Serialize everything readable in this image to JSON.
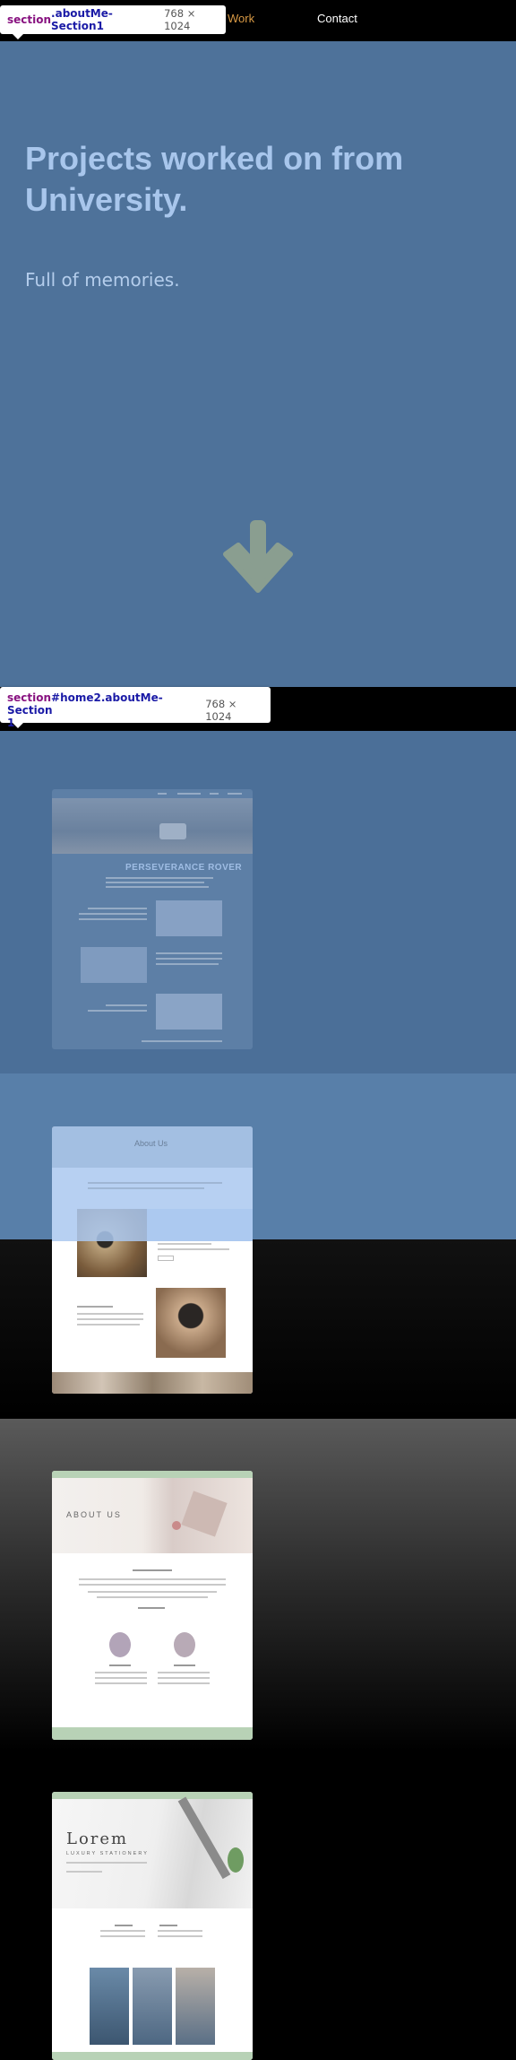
{
  "nav": {
    "work": "Work",
    "contact": "Contact"
  },
  "inspector": {
    "badge1": {
      "tag": "section",
      "cls": ".aboutMe-Section1",
      "dim": "768 × 1024"
    },
    "badge2": {
      "tag": "section",
      "cls": "#home2.aboutMe-Section",
      "cls_cont": "1",
      "dim": "768 × 1024"
    }
  },
  "hero": {
    "title": "Projects worked on from University.",
    "subtitle": "Full of memories."
  },
  "projects": {
    "perseverance": {
      "heading": "PERSEVERANCE ROVER"
    },
    "about_us": {
      "heading": "About Us"
    },
    "about_us_2": {
      "heading": "ABOUT US"
    },
    "lorem": {
      "heading": "Lorem",
      "tagline": "LUXURY STATIONERY"
    }
  },
  "colors": {
    "section_bg": "#4e729a",
    "hero_title": "#a8c6ec",
    "arrow": "#8a9e90",
    "nav_active": "#d99a45"
  }
}
